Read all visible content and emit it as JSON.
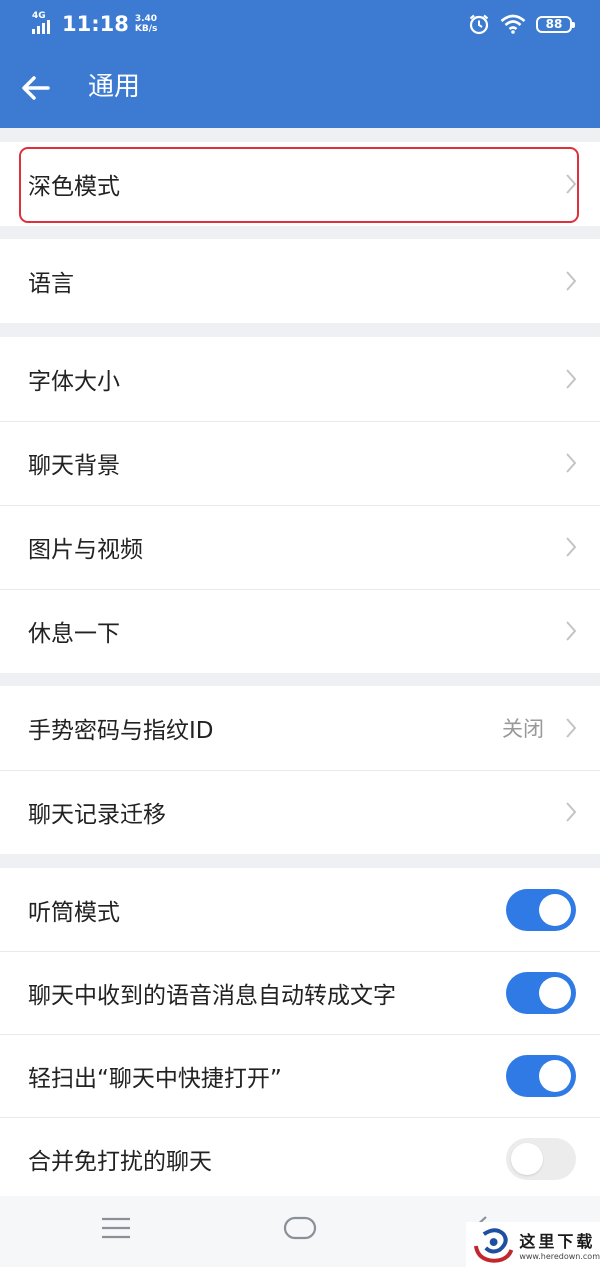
{
  "status_bar": {
    "network": "4G",
    "time": "11:18",
    "speed_value": "3.40",
    "speed_unit": "KB/s",
    "battery": "88"
  },
  "header": {
    "title": "通用",
    "back_icon": "arrow-left-icon"
  },
  "groups": [
    {
      "items": [
        {
          "label": "深色模式",
          "highlighted": true
        }
      ]
    },
    {
      "items": [
        {
          "label": "语言"
        }
      ]
    },
    {
      "items": [
        {
          "label": "字体大小"
        },
        {
          "label": "聊天背景"
        },
        {
          "label": "图片与视频"
        },
        {
          "label": "休息一下"
        }
      ]
    },
    {
      "items": [
        {
          "label": "手势密码与指纹ID",
          "value": "关闭"
        },
        {
          "label": "聊天记录迁移"
        }
      ]
    },
    {
      "items": [
        {
          "label": "听筒模式",
          "toggle": true
        },
        {
          "label": "聊天中收到的语音消息自动转成文字",
          "toggle": true
        },
        {
          "label": "轻扫出“聊天中快捷打开”",
          "toggle": true
        },
        {
          "label": "合并免打扰的聊天",
          "toggle": false
        }
      ]
    }
  ],
  "colors": {
    "primary": "#3c7bd1",
    "toggle_on": "#2f7ae5",
    "highlight_border": "#e0303a"
  },
  "watermark": {
    "text": "这里下载",
    "url": "www.heredown.com"
  }
}
